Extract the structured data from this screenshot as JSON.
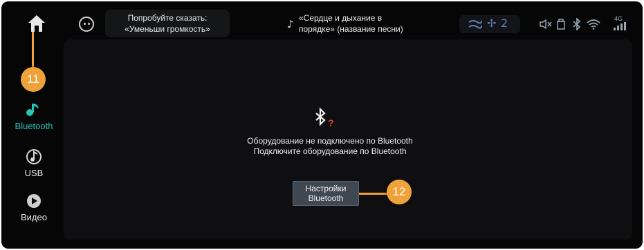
{
  "topbar": {
    "voice_hint_line1": "Попробуйте сказать:",
    "voice_hint_line2": "«Уменьши громкость»",
    "song_hint_line1": "«Сердце и дыхание в",
    "song_hint_line2": "порядке» (название песни)",
    "status": {
      "hvac_icon": "airflow-icon",
      "fan_level": "2",
      "mute_icon": "speaker-mute-icon",
      "usb_icon": "usb-icon",
      "bluetooth_icon": "bluetooth-icon",
      "wifi_icon": "wifi-icon",
      "signal_label": "4G"
    }
  },
  "sidebar": {
    "home_icon": "home-icon",
    "callout_home": "11",
    "items": [
      {
        "label": "Bluetooth",
        "icon": "bluetooth-music-icon",
        "active": true
      },
      {
        "label": "USB",
        "icon": "usb-music-icon",
        "active": false
      },
      {
        "label": "Видео",
        "icon": "video-play-icon",
        "active": false
      }
    ]
  },
  "main": {
    "status_icon": "bluetooth-disconnected-icon",
    "message_line1": "Оборудование не подключено по Bluetooth",
    "message_line2": "Подключите оборудование по Bluetooth",
    "settings_button_line1": "Настройки",
    "settings_button_line2": "Bluetooth",
    "callout_button": "12"
  },
  "colors": {
    "accent_teal": "#26c3b7",
    "callout_orange": "#f0a23a",
    "bt_question_red": "#e03a3a",
    "background": "#060606"
  }
}
